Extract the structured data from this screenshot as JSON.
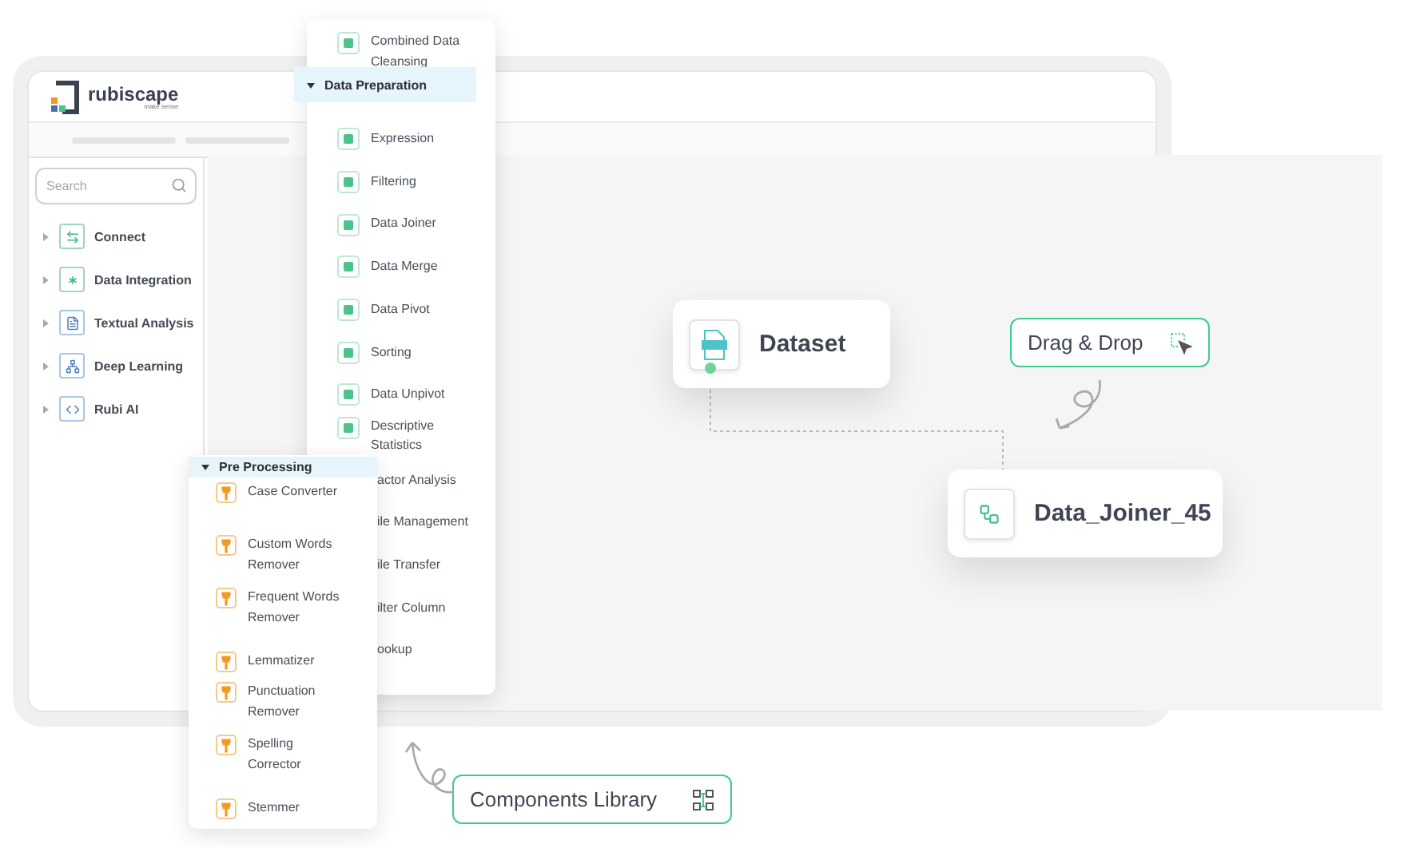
{
  "logo": {
    "name": "rubiscape",
    "tagline": "make sense"
  },
  "search": {
    "placeholder": "Search"
  },
  "sidebar": {
    "items": [
      {
        "label": "Connect",
        "expanded": false
      },
      {
        "label": "Data Integration",
        "expanded": false
      },
      {
        "label": "Textual Analysis",
        "expanded": false
      },
      {
        "label": "Deep Learning",
        "expanded": false
      },
      {
        "label": "Rubi AI",
        "expanded": false
      }
    ]
  },
  "data_preparation": {
    "title": "Data Preparation",
    "expanded": true,
    "items": [
      {
        "label": "Expression",
        "kind": "full"
      },
      {
        "label": "Filtering",
        "kind": "full"
      },
      {
        "label": "Data Joiner",
        "kind": "full"
      },
      {
        "label": "Data Merge",
        "kind": "full"
      },
      {
        "label": "Data Pivot",
        "kind": "full"
      },
      {
        "label": "Sorting",
        "kind": "full"
      },
      {
        "label": "Data Unpivot",
        "kind": "full"
      },
      {
        "label": "Descriptive Statistics",
        "kind": "full"
      },
      {
        "label": "actor Analysis",
        "kind": "clipped"
      },
      {
        "label": "ile Management",
        "kind": "clipped"
      },
      {
        "label": "ile Transfer",
        "kind": "clipped"
      },
      {
        "label": "ilter Column",
        "kind": "clipped"
      },
      {
        "label": "ookup",
        "kind": "clipped"
      }
    ],
    "above": {
      "label": "Combined Data Cleansing"
    }
  },
  "pre_processing": {
    "title": "Pre Processing",
    "expanded": true,
    "items": [
      {
        "label": "Case Converter"
      },
      {
        "label": "Custom Words Remover"
      },
      {
        "label": "Frequent Words Remover"
      },
      {
        "label": "Lemmatizer"
      },
      {
        "label": "Punctuation Remover"
      },
      {
        "label": "Spelling Corrector"
      },
      {
        "label": "Stemmer"
      }
    ]
  },
  "canvas": {
    "nodes": [
      {
        "label": "Dataset",
        "kind": "csv"
      },
      {
        "label": "Data_Joiner_45",
        "kind": "joiner"
      }
    ]
  },
  "callouts": [
    {
      "label": "Drag & Drop",
      "kind": "drag"
    },
    {
      "label": "Components Library",
      "kind": "library"
    }
  ]
}
